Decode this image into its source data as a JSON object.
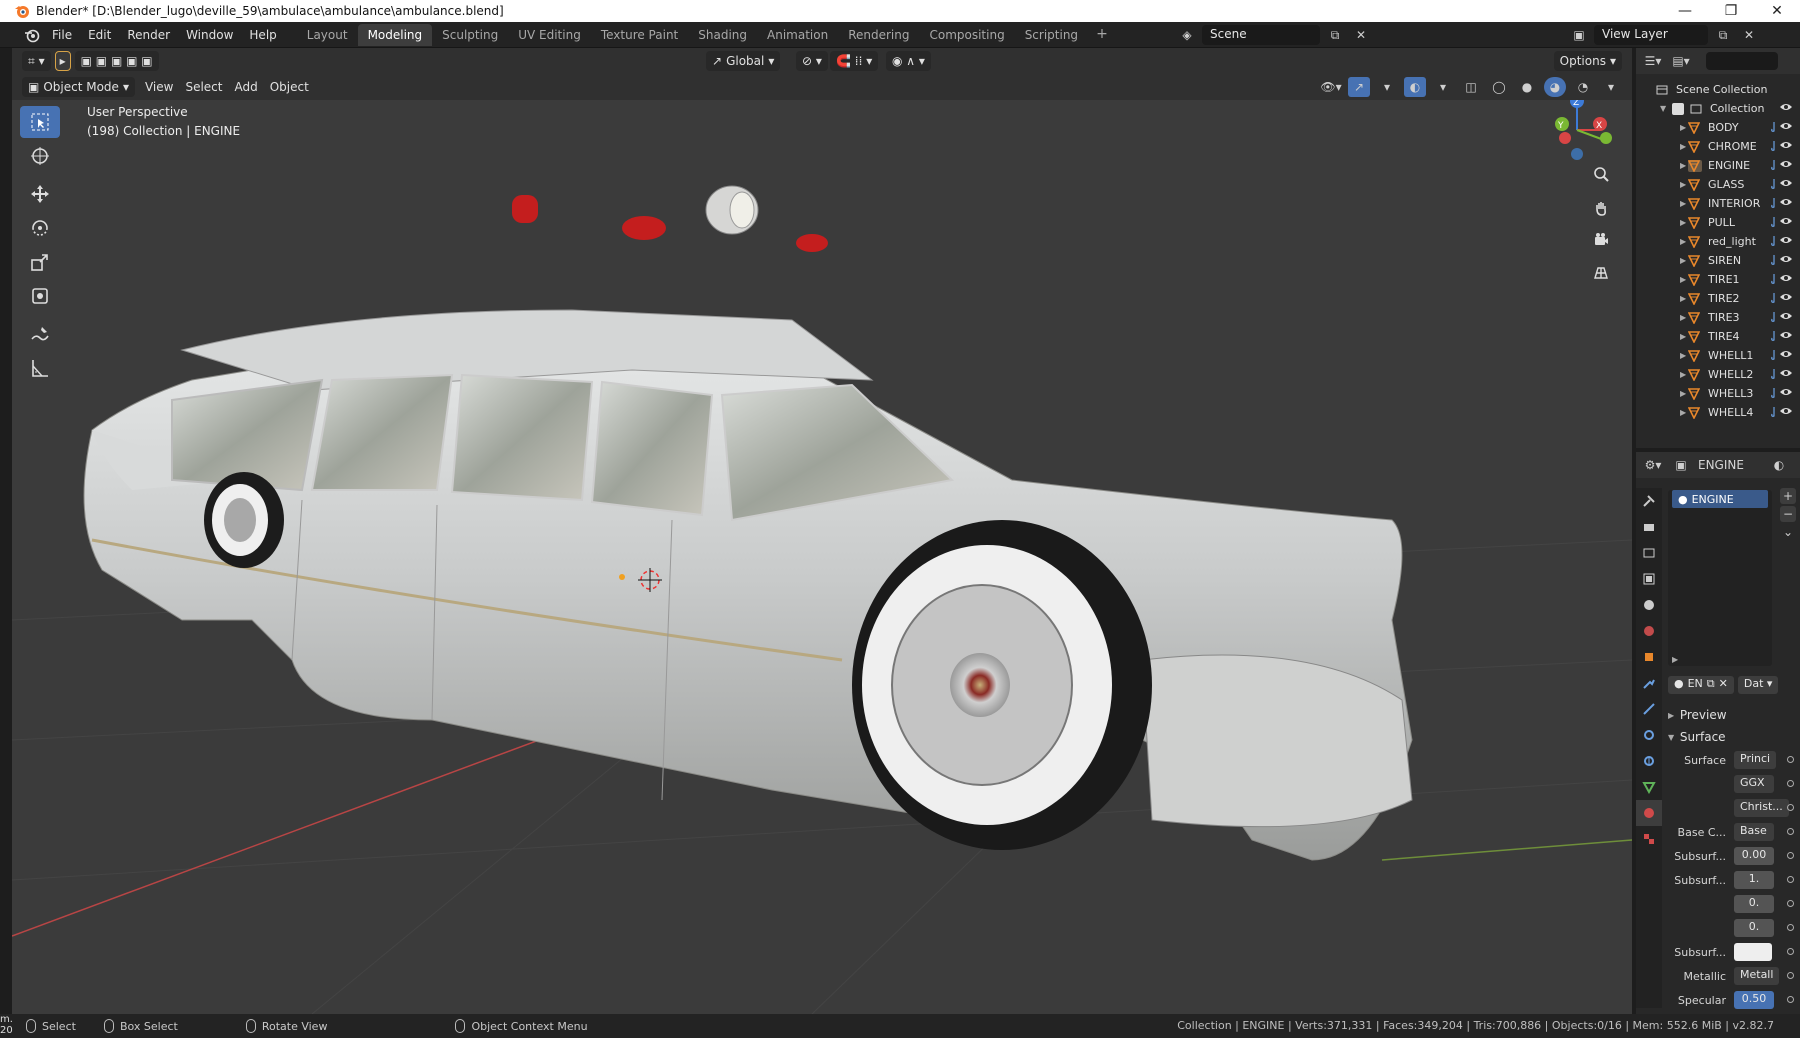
{
  "window": {
    "title": "Blender* [D:\\Blender_lugo\\deville_59\\ambulace\\ambulance\\ambulance.blend]",
    "controls": [
      "—",
      "❐",
      "✕"
    ]
  },
  "menu": {
    "items": [
      "File",
      "Edit",
      "Render",
      "Window",
      "Help"
    ],
    "workspaces": [
      "Layout",
      "Modeling",
      "Sculpting",
      "UV Editing",
      "Texture Paint",
      "Shading",
      "Animation",
      "Rendering",
      "Compositing",
      "Scripting"
    ],
    "active_workspace": "Modeling",
    "add_workspace": "+",
    "scene": "Scene",
    "view_layer": "View Layer"
  },
  "viewport_header": {
    "transform_orientation": "Global",
    "options": "Options",
    "mode": "Object Mode",
    "menus": [
      "View",
      "Select",
      "Add",
      "Object"
    ]
  },
  "viewport": {
    "perspective": "User Perspective",
    "collection_info": "(198) Collection | ENGINE",
    "gizmo_axes": [
      "Z",
      "X",
      "Y"
    ]
  },
  "outliner": {
    "root": "Scene Collection",
    "collection": "Collection",
    "objects": [
      "BODY",
      "CHROME",
      "ENGINE",
      "GLASS",
      "INTERIOR",
      "PULL",
      "red_light",
      "SIREN",
      "TIRE1",
      "TIRE2",
      "TIRE3",
      "TIRE4",
      "WHELL1",
      "WHELL2",
      "WHELL3",
      "WHELL4"
    ]
  },
  "properties": {
    "object_name": "ENGINE",
    "material_slot": "ENGINE",
    "material_field": "EN",
    "data_dropdown": "Dat",
    "panels": {
      "preview": "Preview",
      "surface": "Surface"
    },
    "rows": [
      {
        "label": "Surface",
        "value": "Princi"
      },
      {
        "label": "",
        "value": "GGX"
      },
      {
        "label": "",
        "value": "Christ..."
      },
      {
        "label": "Base C...",
        "value": "Base"
      },
      {
        "label": "Subsurf...",
        "value": "0.00"
      },
      {
        "label": "Subsurf...",
        "value": "1."
      },
      {
        "label": "",
        "value": "0."
      },
      {
        "label": "",
        "value": "0."
      },
      {
        "label": "Subsurf...",
        "value": ""
      },
      {
        "label": "Metallic",
        "value": "Metall"
      },
      {
        "label": "Specular",
        "value": "0.50"
      }
    ]
  },
  "statusbar": {
    "left_cut": "m.",
    "left_cut2": "20",
    "select": "Select",
    "box_select": "Box Select",
    "rotate_view": "Rotate View",
    "context_menu": "Object Context Menu",
    "stats": "Collection | ENGINE | Verts:371,331 | Faces:349,204 | Tris:700,886 | Objects:0/16 | Mem: 552.6 MiB | v2.82.7"
  },
  "colors": {
    "accent": "#4772b3",
    "viewport_bg": "#3b3b3b",
    "panel_bg": "#282828",
    "header_bg": "#303030",
    "mesh_orange": "#e8872b"
  }
}
